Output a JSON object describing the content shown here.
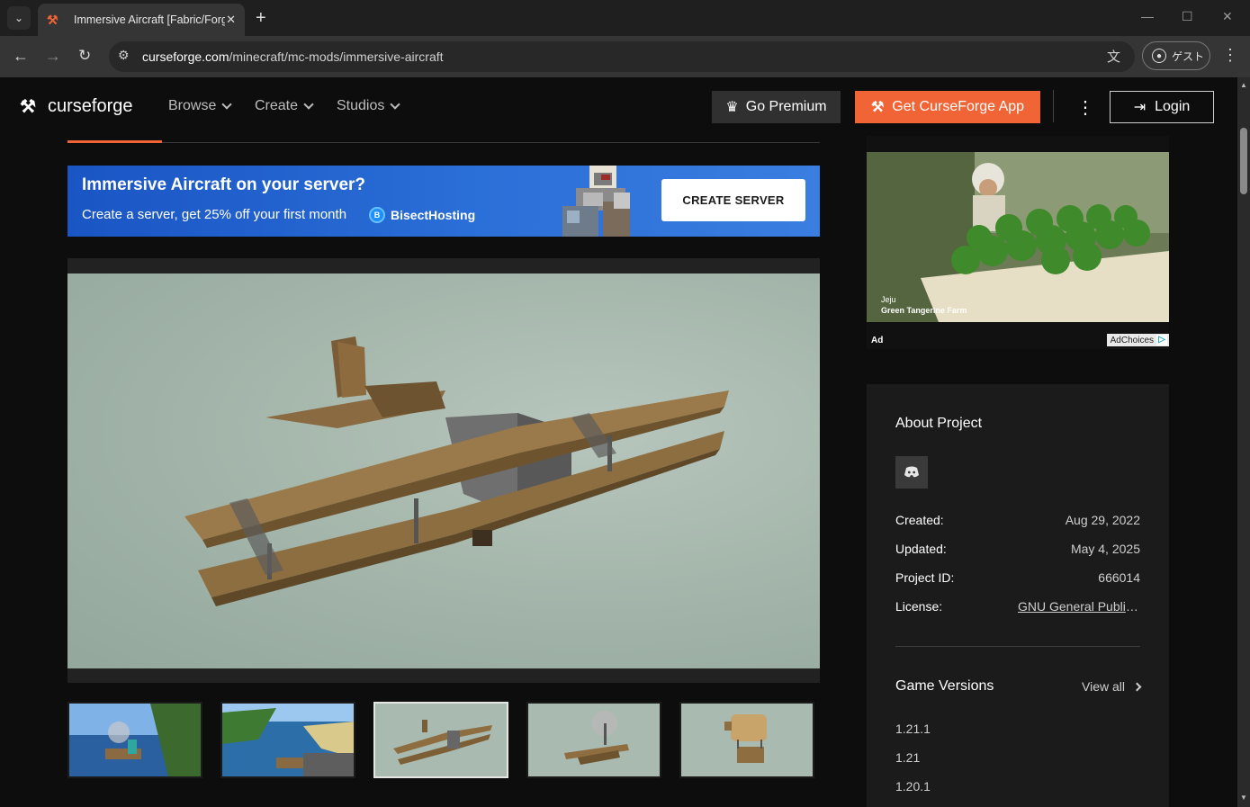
{
  "browser": {
    "tab_title": "Immersive Aircraft [Fabric/Forge]",
    "url_host": "curseforge.com",
    "url_path": "/minecraft/mc-mods/immersive-aircraft",
    "profile_label": "ゲスト"
  },
  "header": {
    "logo_text": "curseforge",
    "nav": [
      "Browse",
      "Create",
      "Studios"
    ],
    "premium_label": "Go Premium",
    "app_label": "Get CurseForge App",
    "login_label": "Login",
    "accent_color": "#f16436"
  },
  "promo": {
    "title": "Immersive Aircraft on your server?",
    "subtitle": "Create a server, get 25% off your first month",
    "brand": "BisectHosting",
    "cta": "CREATE SERVER"
  },
  "gallery": {
    "thumbnail_count": 5,
    "active_thumbnail": 3
  },
  "ad": {
    "caption_line1": "Jeju",
    "caption_line2": "Green Tangerine Farm",
    "ad_label": "Ad",
    "adchoices_label": "AdChoices"
  },
  "about": {
    "title": "About Project",
    "created_label": "Created:",
    "created_value": "Aug 29, 2022",
    "updated_label": "Updated:",
    "updated_value": "May 4, 2025",
    "project_id_label": "Project ID:",
    "project_id_value": "666014",
    "license_label": "License:",
    "license_value": "GNU General Public..."
  },
  "game_versions": {
    "title": "Game Versions",
    "view_all": "View all",
    "items": [
      "1.21.1",
      "1.21",
      "1.20.1"
    ]
  }
}
